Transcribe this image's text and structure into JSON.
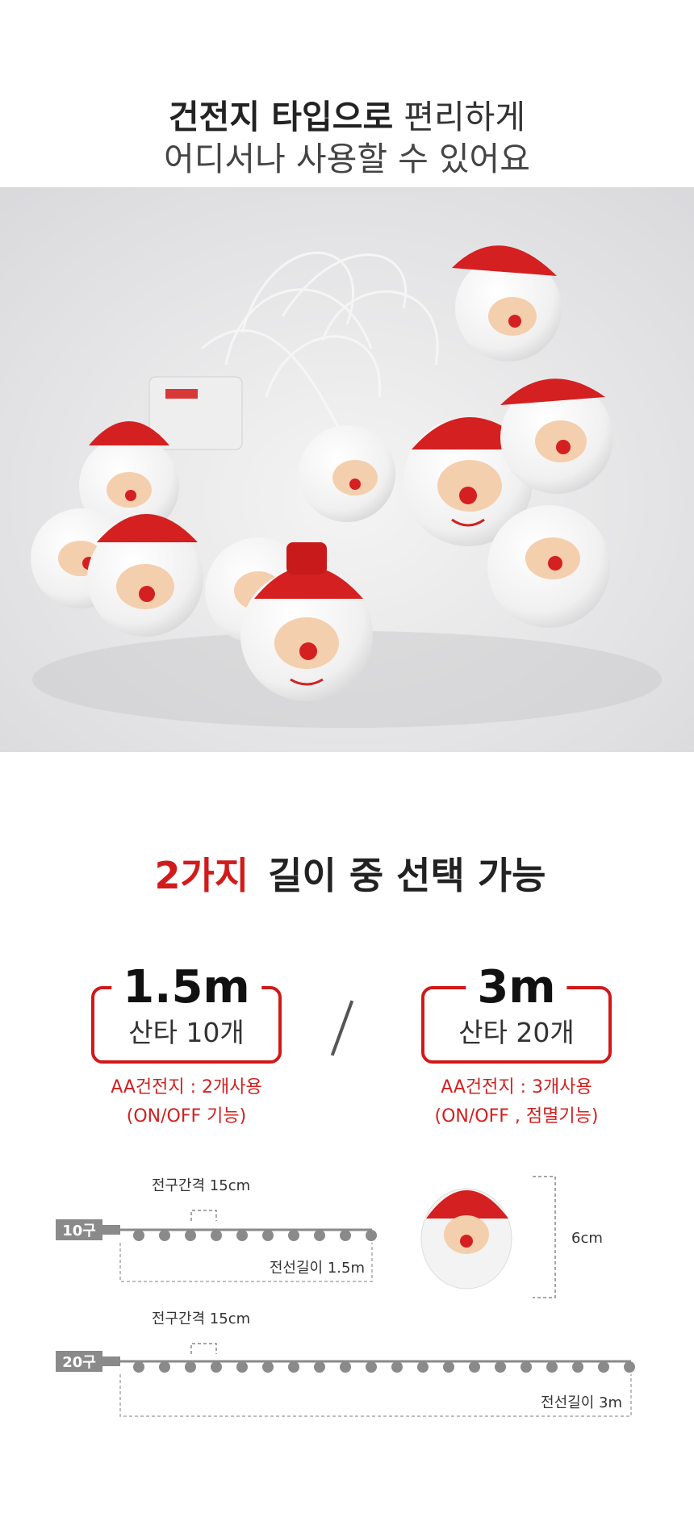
{
  "headline": {
    "line1_bold": "건전지 타입으로",
    "line1_rest": " 편리하게",
    "line2": "어디서나 사용할 수 있어요"
  },
  "section": {
    "title_highlight": "2가지",
    "title_rest": " 길이 중 선택 가능"
  },
  "options": [
    {
      "length": "1.5m",
      "label": "산타 10개",
      "battery": "AA건전지 : 2개사용",
      "function": "(ON/OFF 기능)"
    },
    {
      "length": "3m",
      "label": "산타 20개",
      "battery": "AA건전지 : 3개사용",
      "function": "(ON/OFF , 점멸기능)"
    }
  ],
  "diagram": {
    "short": {
      "tag": "10구",
      "spacing": "전구간격 15cm",
      "wire": "전선길이 1.5m",
      "bulbs": 10
    },
    "long": {
      "tag": "20구",
      "spacing": "전구간격 15cm",
      "wire": "전선길이 3m",
      "bulbs": 20
    },
    "bulb_height": "6cm"
  },
  "colors": {
    "accent_red": "#d21818",
    "highlight_yellow": "#ffeb3b",
    "bulb_gray": "#8a8a8a"
  }
}
